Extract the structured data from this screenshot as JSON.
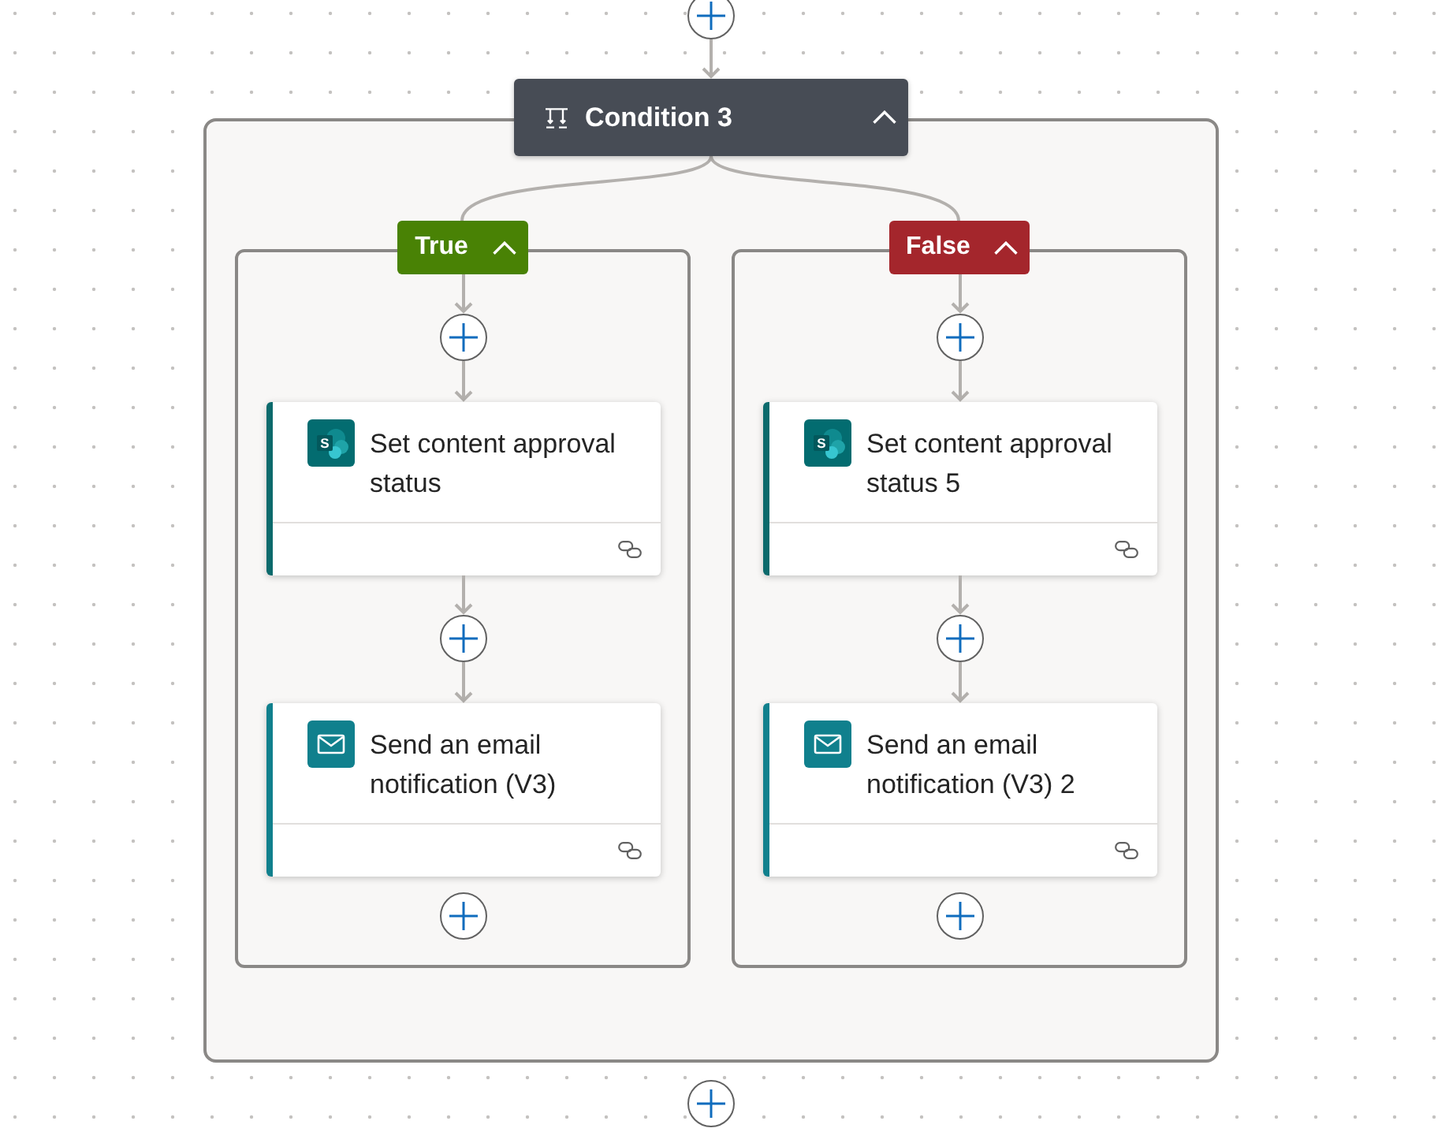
{
  "condition": {
    "title": "Condition 3",
    "expanded": true
  },
  "branches": [
    {
      "label": "True",
      "color": "#498205",
      "expanded": true,
      "actions": [
        {
          "kind": "sharepoint",
          "title": "Set content approval status",
          "logo_text": "S"
        },
        {
          "kind": "email",
          "title": "Send an email notification (V3)"
        }
      ]
    },
    {
      "label": "False",
      "color": "#a4262c",
      "expanded": true,
      "actions": [
        {
          "kind": "sharepoint",
          "title": "Set content approval status 5",
          "logo_text": "S"
        },
        {
          "kind": "email",
          "title": "Send an email notification (V3) 2"
        }
      ]
    }
  ]
}
